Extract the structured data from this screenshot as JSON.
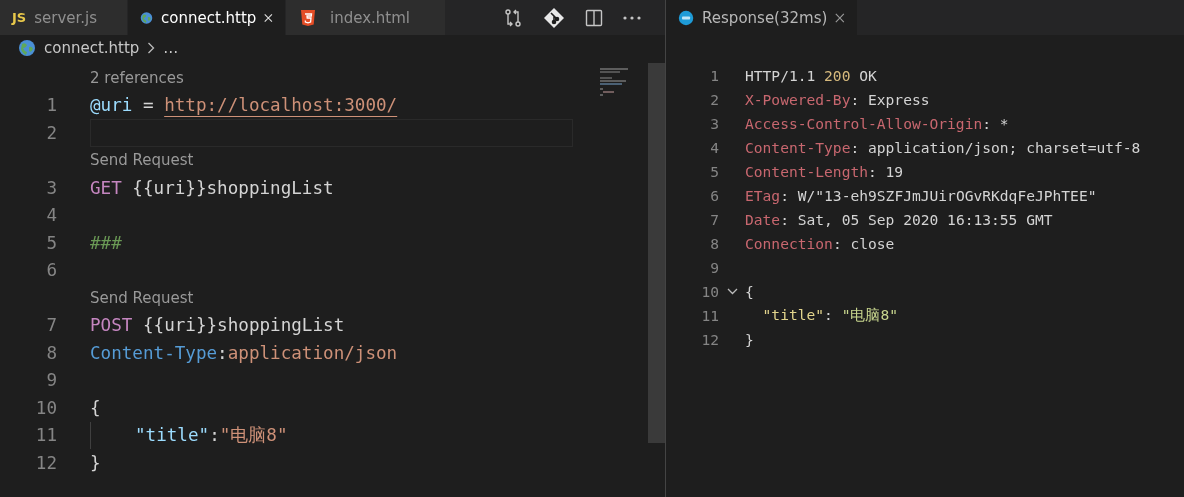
{
  "left_pane": {
    "tabs": [
      {
        "label": "server.js",
        "kind": "js",
        "icon_text": "JS",
        "selected": false,
        "closable": false
      },
      {
        "label": "connect.http",
        "kind": "http",
        "selected": true,
        "closable": true
      },
      {
        "label": "index.html",
        "kind": "html",
        "selected": false,
        "closable": false
      }
    ],
    "breadcrumb": {
      "file": "connect.http",
      "ellipsis": "…"
    },
    "editor": {
      "lines": [
        {
          "number": "1",
          "lens": "2 references",
          "tokens": [
            {
              "kind": "variable",
              "text": "@uri"
            },
            {
              "kind": "plain",
              "text": " = "
            },
            {
              "kind": "url",
              "text": "http://localhost:3000/"
            }
          ]
        },
        {
          "number": "2",
          "current": true
        },
        {
          "number": "3",
          "lens": "Send Request",
          "tokens": [
            {
              "kind": "method",
              "text": "GET"
            },
            {
              "kind": "plain",
              "text": " {{uri}}shoppingList"
            }
          ]
        },
        {
          "number": "4"
        },
        {
          "number": "5",
          "tokens": [
            {
              "kind": "comment",
              "text": "###"
            }
          ]
        },
        {
          "number": "6"
        },
        {
          "number": "7",
          "lens": "Send Request",
          "tokens": [
            {
              "kind": "method",
              "text": "POST"
            },
            {
              "kind": "plain",
              "text": " {{uri}}shoppingList"
            }
          ]
        },
        {
          "number": "8",
          "tokens": [
            {
              "kind": "header",
              "text": "Content-Type"
            },
            {
              "kind": "plain",
              "text": ":"
            },
            {
              "kind": "string",
              "text": "application/json"
            }
          ]
        },
        {
          "number": "9"
        },
        {
          "number": "10",
          "tokens": [
            {
              "kind": "plain",
              "text": "{"
            }
          ]
        },
        {
          "number": "11",
          "indent": true,
          "tokens": [
            {
              "kind": "key",
              "text": "\"title\""
            },
            {
              "kind": "plain",
              "text": ":"
            },
            {
              "kind": "string",
              "text": "\"电脑8\""
            }
          ]
        },
        {
          "number": "12",
          "tokens": [
            {
              "kind": "plain",
              "text": "}"
            }
          ]
        }
      ]
    }
  },
  "right_pane": {
    "tab": {
      "label": "Response(32ms)",
      "selected": true,
      "closable": true
    },
    "lines": [
      {
        "number": "1",
        "tokens": [
          {
            "kind": "plain",
            "text": "HTTP/1.1 "
          },
          {
            "kind": "status",
            "text": "200"
          },
          {
            "kind": "plain",
            "text": " OK"
          }
        ]
      },
      {
        "number": "2",
        "tokens": [
          {
            "kind": "field",
            "text": "X-Powered-By"
          },
          {
            "kind": "plain",
            "text": ": Express"
          }
        ]
      },
      {
        "number": "3",
        "tokens": [
          {
            "kind": "field",
            "text": "Access-Control-Allow-Origin"
          },
          {
            "kind": "plain",
            "text": ": *"
          }
        ]
      },
      {
        "number": "4",
        "tokens": [
          {
            "kind": "field",
            "text": "Content-Type"
          },
          {
            "kind": "plain",
            "text": ": application/json; charset=utf-8"
          }
        ]
      },
      {
        "number": "5",
        "tokens": [
          {
            "kind": "field",
            "text": "Content-Length"
          },
          {
            "kind": "plain",
            "text": ": 19"
          }
        ]
      },
      {
        "number": "6",
        "tokens": [
          {
            "kind": "field",
            "text": "ETag"
          },
          {
            "kind": "plain",
            "text": ": W/\"13-eh9SZFJmJUirOGvRKdqFeJPhTEE\""
          }
        ]
      },
      {
        "number": "7",
        "tokens": [
          {
            "kind": "field",
            "text": "Date"
          },
          {
            "kind": "plain",
            "text": ": Sat, 05 Sep 2020 16:13:55 GMT"
          }
        ]
      },
      {
        "number": "8",
        "tokens": [
          {
            "kind": "field",
            "text": "Connection"
          },
          {
            "kind": "plain",
            "text": ": close"
          }
        ]
      },
      {
        "number": "9"
      },
      {
        "number": "10",
        "expanded": true,
        "tokens": [
          {
            "kind": "plain",
            "text": "{"
          }
        ]
      },
      {
        "number": "11",
        "tokens": [
          {
            "kind": "jkey",
            "text": "  \"title\""
          },
          {
            "kind": "plain",
            "text": ": "
          },
          {
            "kind": "jstring",
            "text": "\"电脑8\""
          }
        ]
      },
      {
        "number": "12",
        "tokens": [
          {
            "kind": "plain",
            "text": "}"
          }
        ]
      }
    ]
  }
}
